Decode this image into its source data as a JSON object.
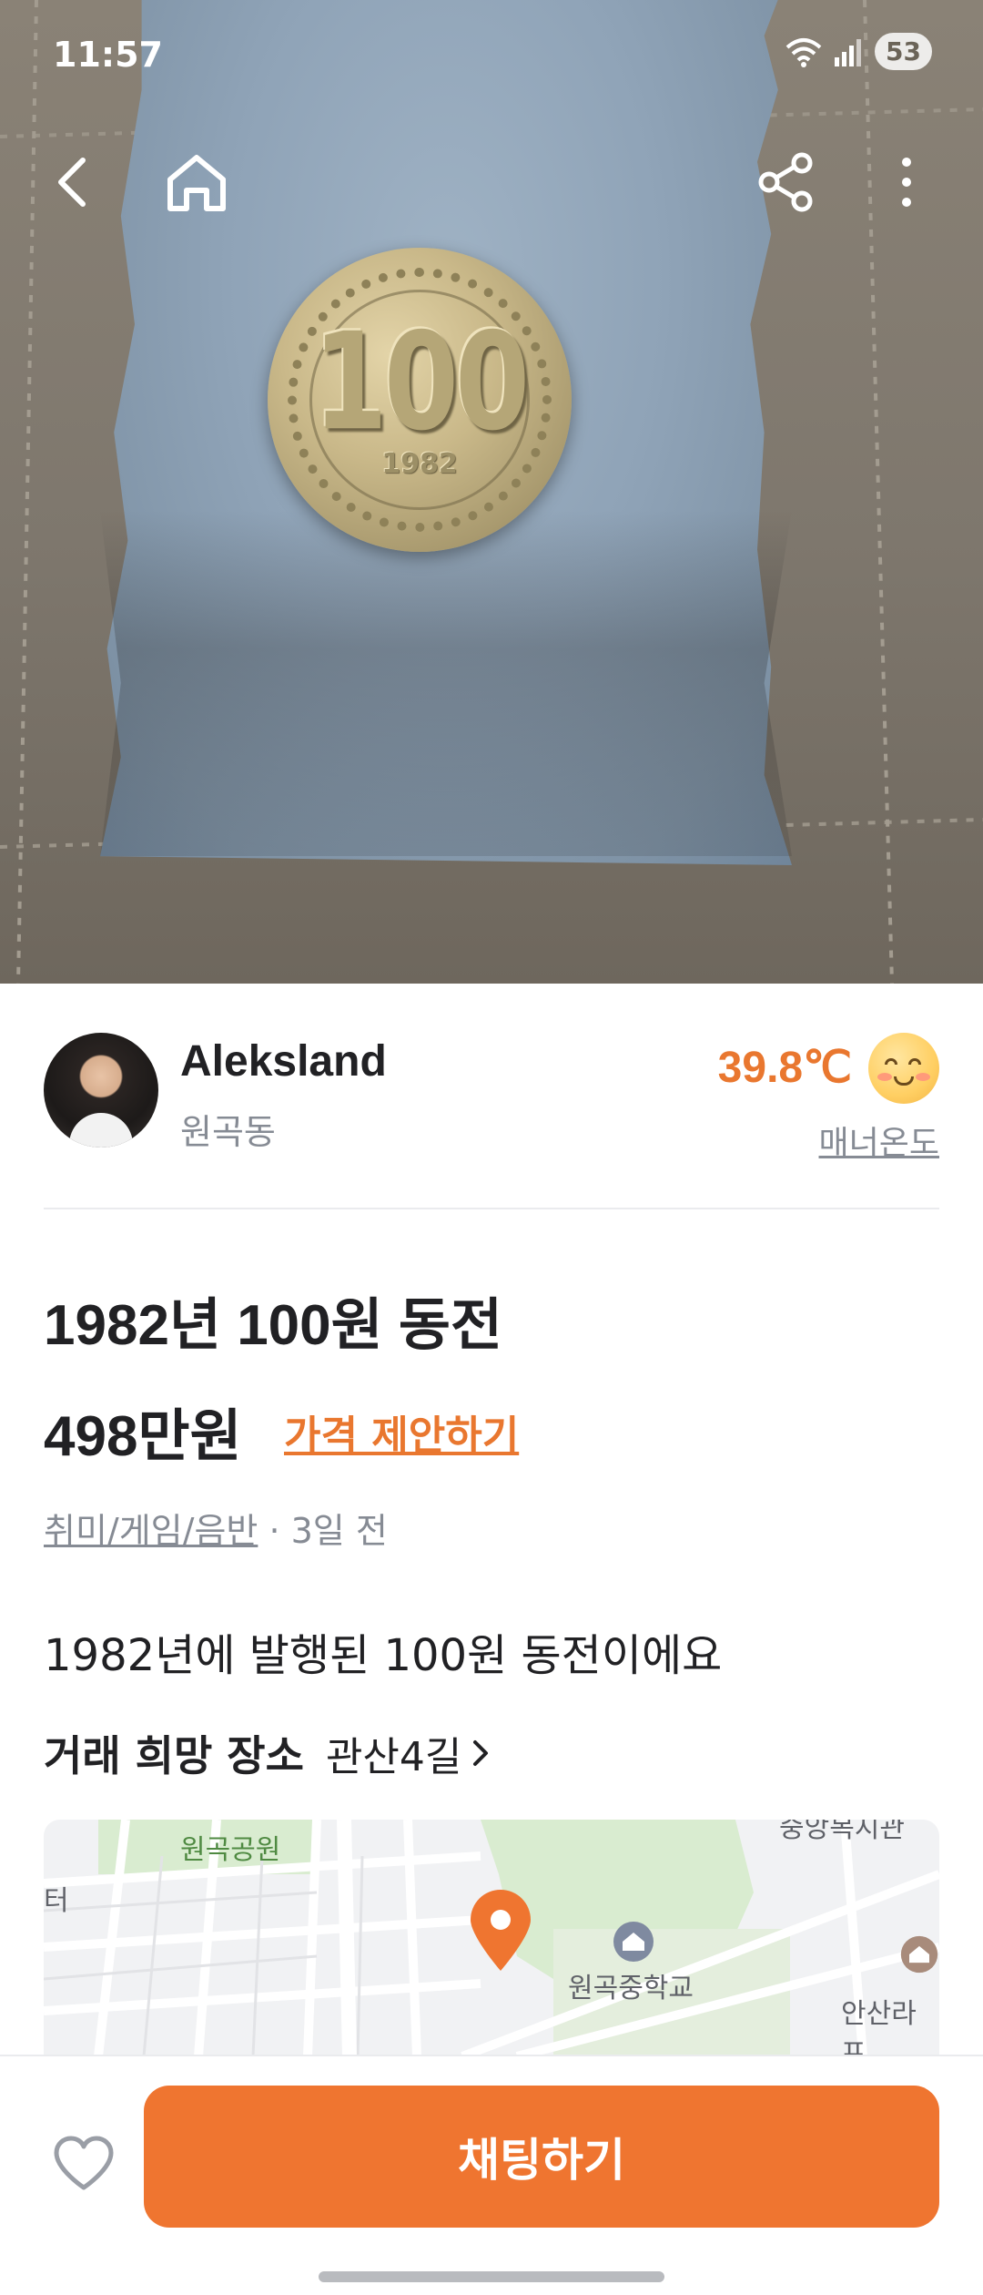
{
  "status_bar": {
    "time": "11:57",
    "battery": "53"
  },
  "photo": {
    "coin_value": "100",
    "coin_year": "1982"
  },
  "seller": {
    "name": "Aleksland",
    "region": "원곡동",
    "temperature": "39.8℃",
    "manner_label": "매너온도"
  },
  "product": {
    "title": "1982년 100원 동전",
    "price": "498만원",
    "offer_label": "가격 제안하기",
    "category": "취미/게임/음반",
    "time_ago": " · 3일 전",
    "description": "1982년에 발행된 100원 동전이에요",
    "place_label": "거래 희망 장소",
    "place_value": "관산4길"
  },
  "map": {
    "labels": {
      "park": "원곡공원",
      "left_cut": "터",
      "school": "원곡중학교",
      "right_cut": "안산라프",
      "top_right_cut": "중앙복지관"
    }
  },
  "bottom_bar": {
    "chat_label": "채팅하기"
  },
  "colors": {
    "accent": "#ef7530",
    "text": "#212124",
    "muted": "#868b94"
  }
}
